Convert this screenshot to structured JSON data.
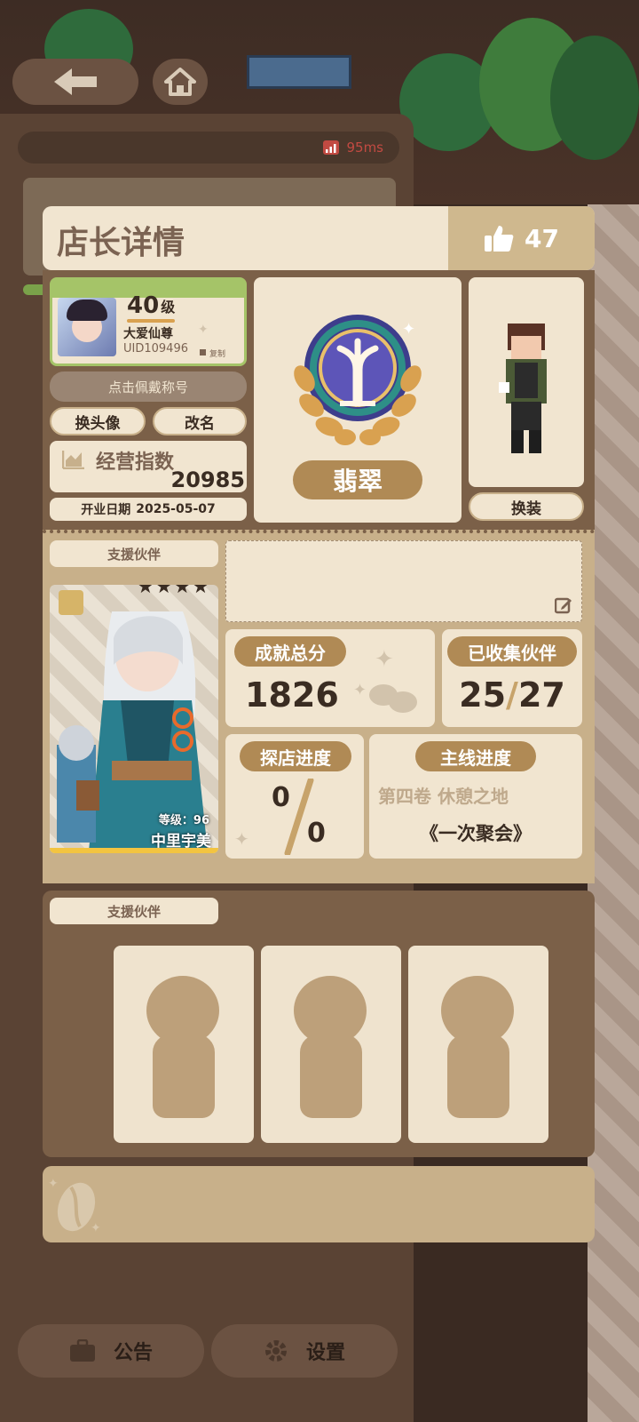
{
  "status": {
    "ping": "95ms"
  },
  "card": {
    "title": "店长详情",
    "likes": "47"
  },
  "profile": {
    "level_number": "40",
    "level_unit": "级",
    "title_name": "大爱仙尊",
    "uid": "UID109496",
    "copy_label": "复制",
    "wear_title_label": "点击佩戴称号",
    "change_avatar_label": "换头像",
    "rename_label": "改名",
    "business_index_label": "经营指数",
    "business_index_value": "20985",
    "open_date_label": "开业日期",
    "open_date_value": "2025-05-07"
  },
  "rank": {
    "name": "翡翠"
  },
  "outfit": {
    "change_label": "换装"
  },
  "partner": {
    "section_label": "支援伙伴",
    "level_label": "等级：96",
    "name": "中里宇美",
    "stars": 4
  },
  "stats": {
    "achievement_label": "成就总分",
    "achievement_value": "1826",
    "collected_label": "已收集伙伴",
    "collected_value": "25",
    "collected_total": "27",
    "explore_label": "探店进度",
    "explore_value": "0",
    "explore_total": "0",
    "main_label": "主线进度",
    "main_volume": "第四卷 休憩之地",
    "main_chapter": "《一次聚会》"
  },
  "support": {
    "section_label": "支援伙伴"
  },
  "bottom": {
    "notice_label": "公告",
    "settings_label": "设置"
  },
  "colors": {
    "cream": "#f1e5d0",
    "brown": "#7b6048",
    "gold_tag": "#b08a55",
    "ping_red": "#c24a42"
  }
}
